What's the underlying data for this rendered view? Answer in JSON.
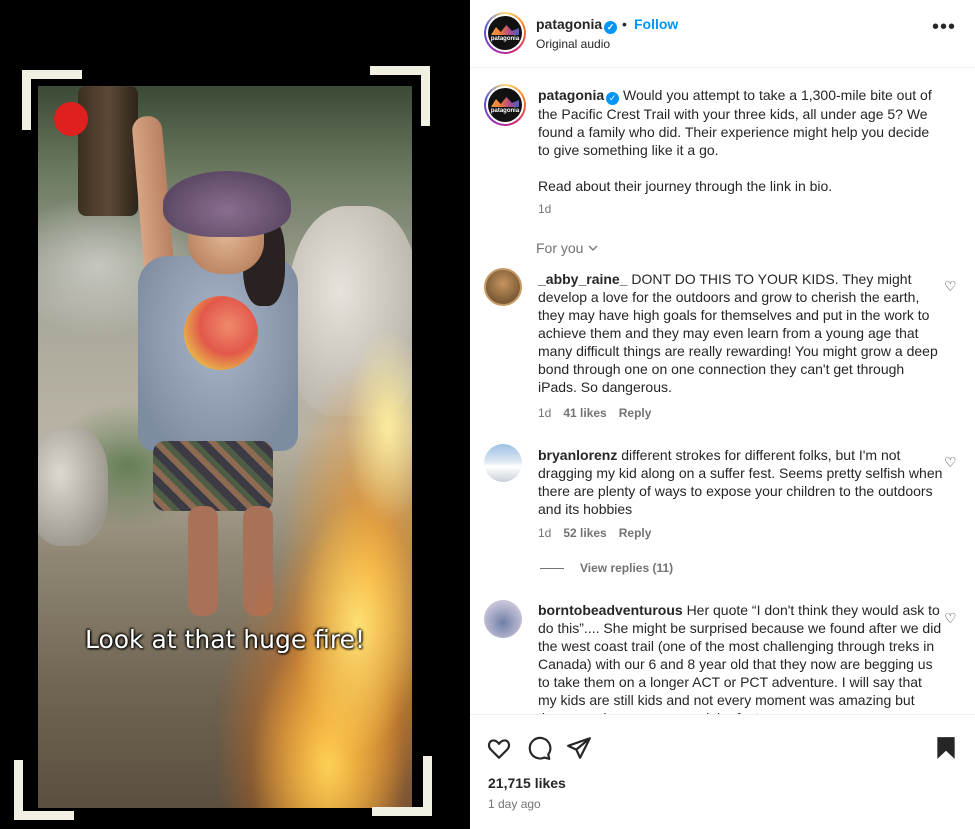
{
  "media": {
    "caption": "Look at that huge fire!"
  },
  "header": {
    "username": "patagonia",
    "separator": "•",
    "follow_label": "Follow",
    "audio": "Original audio",
    "more_label": "•••",
    "avatar_text": "patagonia"
  },
  "post": {
    "username": "patagonia",
    "body": "Would you attempt to take a 1,300-mile bite out of the Pacific Crest Trail with your three kids, all under age 5? We found a family who did. Their experience might help you decide to give something like it a go.",
    "body2": "Read about their journey through the link in bio.",
    "time": "1d"
  },
  "for_you_label": "For you",
  "comments": [
    {
      "username": "_abby_raine_",
      "text": "DONT DO THIS TO YOUR KIDS. They might develop a love for the outdoors and grow to cherish the earth, they may have high goals for themselves and put in the work to achieve them and they may even learn from a young age that many difficult things are really rewarding! You might grow a deep bond through one on one connection they can't get through iPads. So dangerous.",
      "time": "1d",
      "likes": "41 likes",
      "reply": "Reply"
    },
    {
      "username": "bryanlorenz",
      "text": "different strokes for different folks, but I'm not dragging my kid along on a suffer fest. Seems pretty selfish when there are plenty of ways to expose your children to the outdoors and its hobbies",
      "time": "1d",
      "likes": "52 likes",
      "reply": "Reply",
      "view_replies": "View replies (11)"
    },
    {
      "username": "borntobeadventurous",
      "text": "Her quote “I don't think they would ask to do this”.... She might be surprised because we found after we did the west coast trail (one of the most challenging through treks in Canada) with our 6 and 8 year old that they now are begging us to take them on a longer ACT or PCT adventure. I will say that my kids are still kids and not every moment was amazing but they experience, sense and the fact"
    }
  ],
  "footer": {
    "likes": "21,715 likes",
    "ago": "1 day ago"
  },
  "icons": {
    "verified": "verified-badge-icon",
    "heart": "heart-icon",
    "comment": "comment-icon",
    "share": "share-icon",
    "save": "bookmark-icon",
    "chevron": "chevron-down-icon"
  },
  "colors": {
    "accent": "#0095f6",
    "record": "#e0201f",
    "frame": "#f2efe3"
  }
}
